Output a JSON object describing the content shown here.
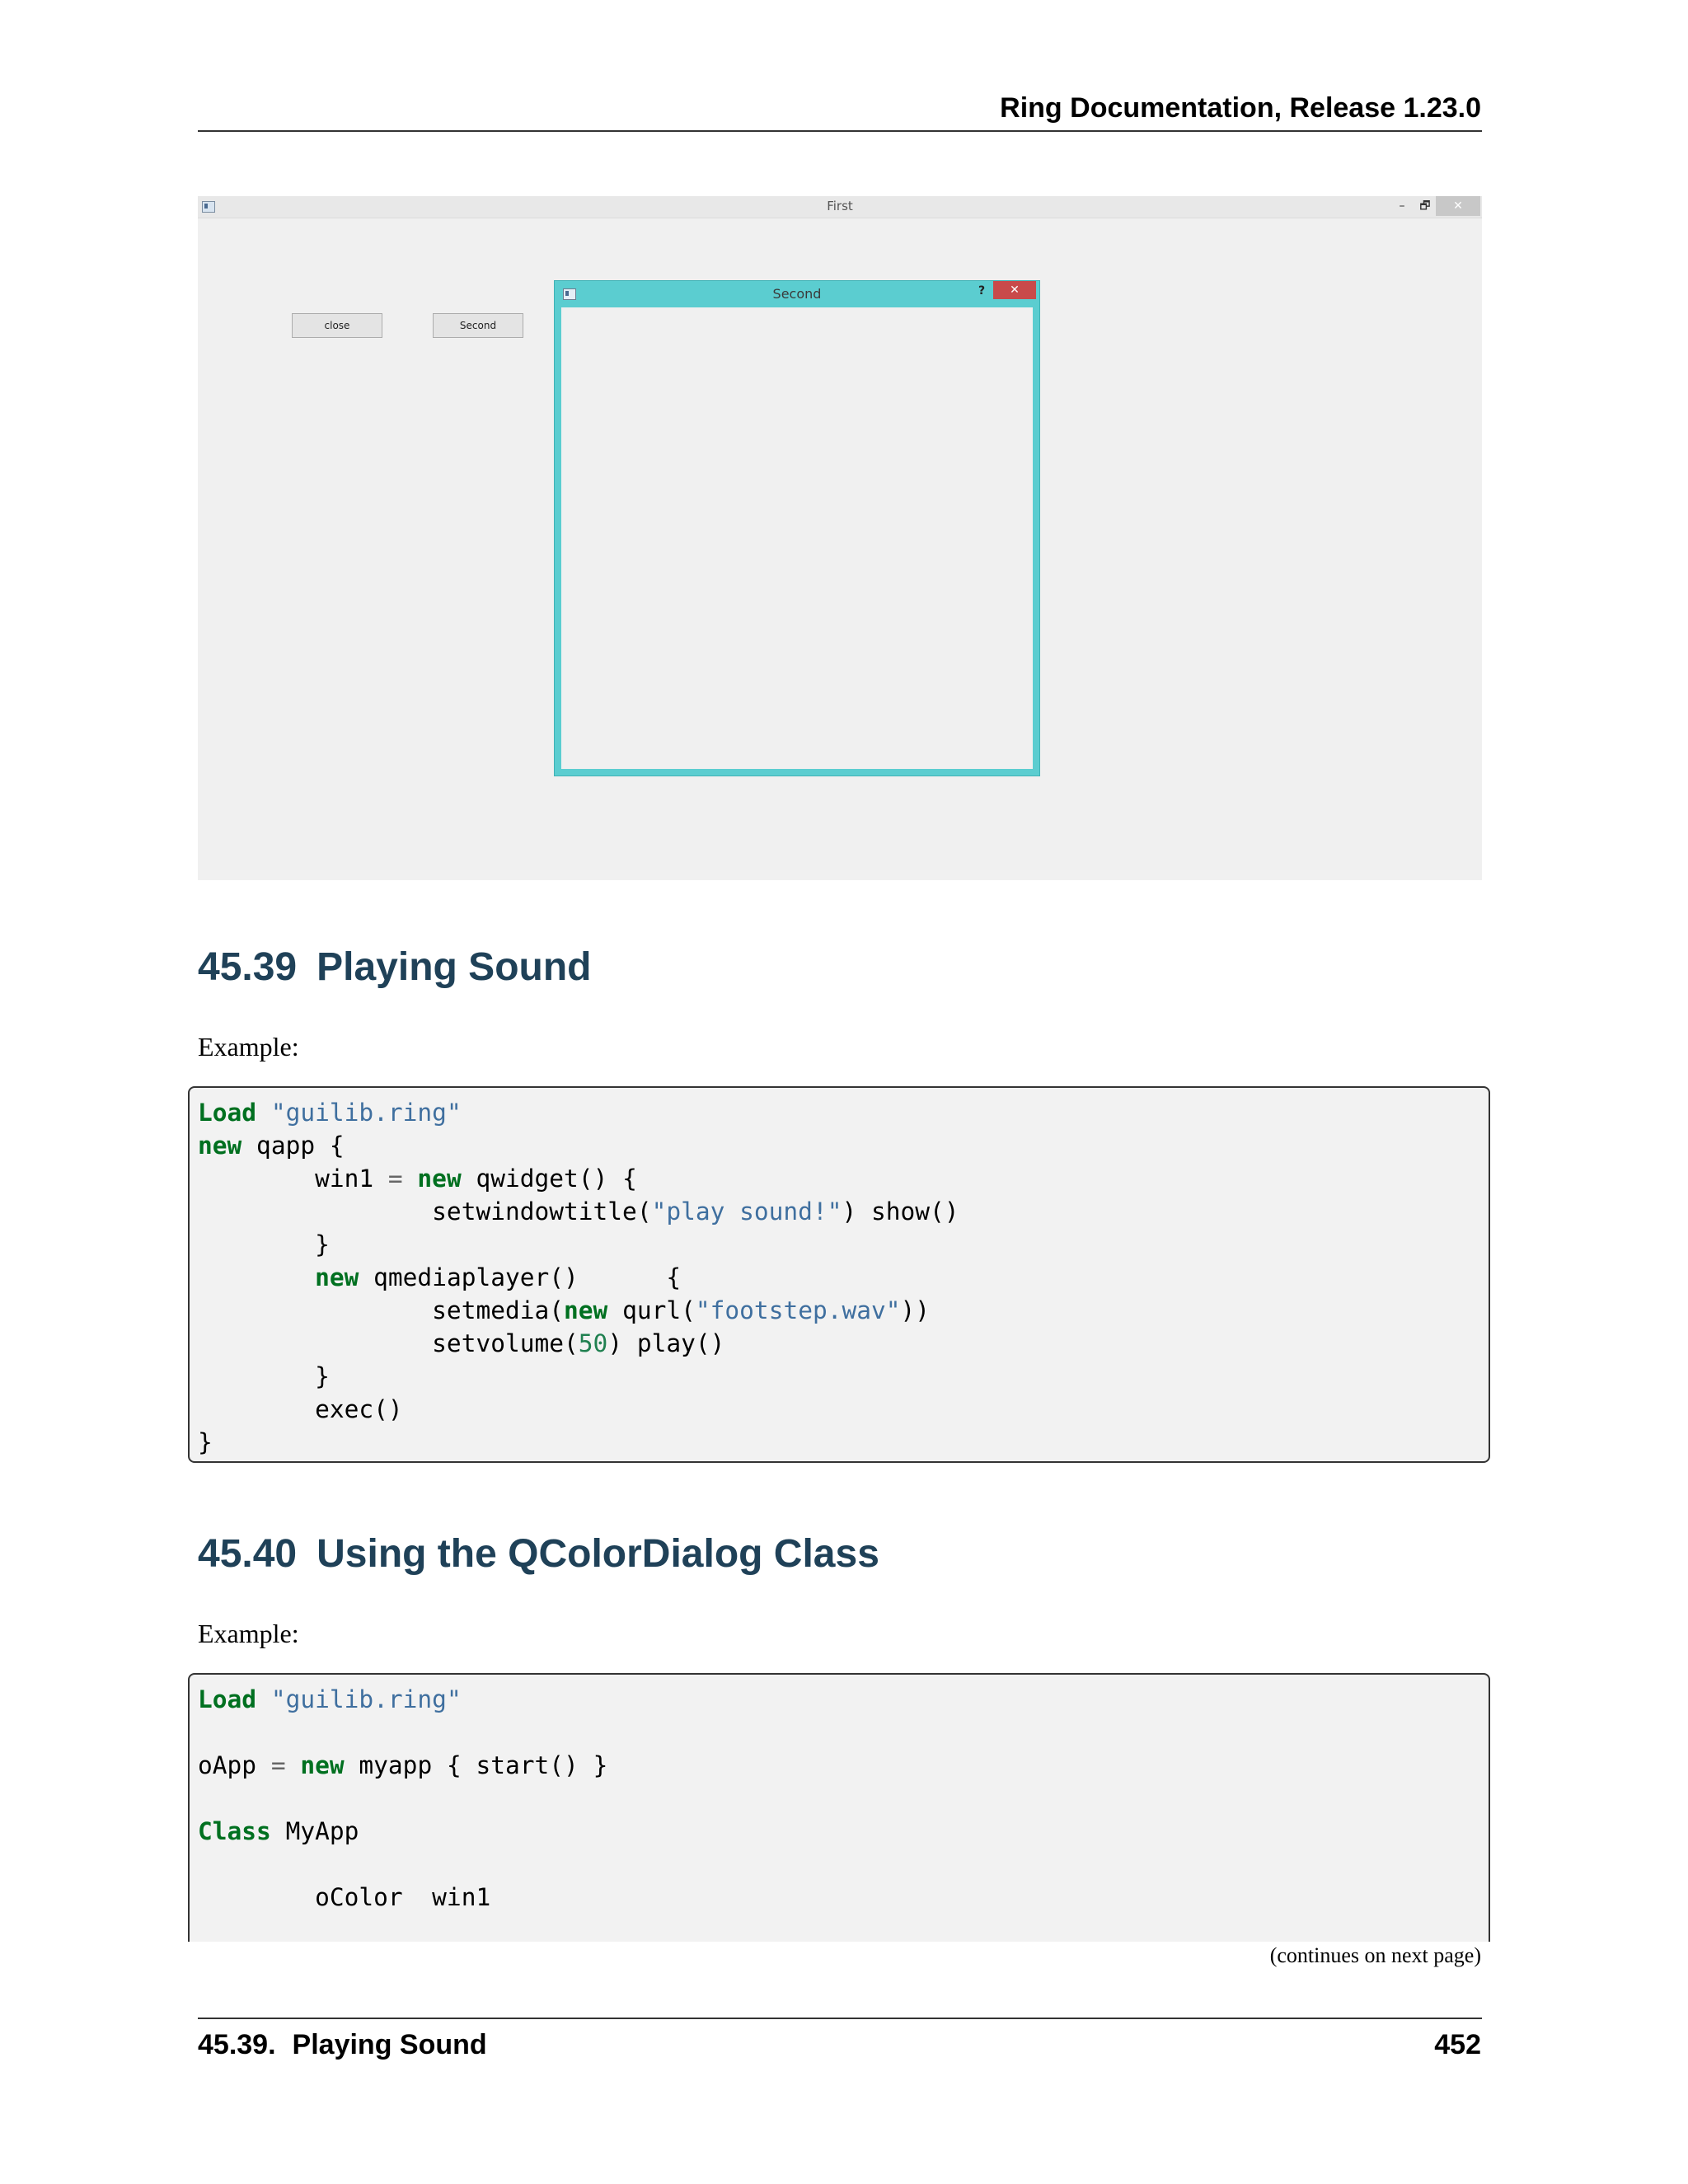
{
  "header": {
    "title": "Ring Documentation, Release 1.23.0"
  },
  "figure": {
    "main_window": {
      "title": "First",
      "minimize_glyph": "–",
      "restore_glyph": "🗗",
      "close_glyph": "✕",
      "buttons": {
        "close_label": "close",
        "second_label": "Second"
      }
    },
    "dialog": {
      "title": "Second",
      "help_glyph": "?",
      "close_glyph": "✕"
    }
  },
  "sections": [
    {
      "number": "45.39",
      "title": "Playing Sound",
      "intro": "Example:"
    },
    {
      "number": "45.40",
      "title": "Using the QColorDialog Class",
      "intro": "Example:"
    }
  ],
  "code_blocks": [
    [
      [
        [
          "kw",
          "Load"
        ],
        [
          "t",
          " "
        ],
        [
          "str",
          "\"guilib.ring\""
        ]
      ],
      [
        [
          "kw",
          "new"
        ],
        [
          "t",
          " qapp {"
        ]
      ],
      [
        [
          "t",
          "        win1 "
        ],
        [
          "op",
          "="
        ],
        [
          "t",
          " "
        ],
        [
          "kw",
          "new"
        ],
        [
          "t",
          " qwidget() {"
        ]
      ],
      [
        [
          "t",
          "                setwindowtitle("
        ],
        [
          "str",
          "\"play sound!\""
        ],
        [
          "t",
          ") show()"
        ]
      ],
      [
        [
          "t",
          "        }"
        ]
      ],
      [
        [
          "t",
          "        "
        ],
        [
          "kw",
          "new"
        ],
        [
          "t",
          " qmediaplayer()      {"
        ]
      ],
      [
        [
          "t",
          "                setmedia("
        ],
        [
          "kw",
          "new"
        ],
        [
          "t",
          " qurl("
        ],
        [
          "str",
          "\"footstep.wav\""
        ],
        [
          "t",
          "))"
        ]
      ],
      [
        [
          "t",
          "                setvolume("
        ],
        [
          "num",
          "50"
        ],
        [
          "t",
          ") play()"
        ]
      ],
      [
        [
          "t",
          "        }"
        ]
      ],
      [
        [
          "t",
          "        exec()"
        ]
      ],
      [
        [
          "t",
          "}"
        ]
      ]
    ],
    [
      [
        [
          "kw",
          "Load"
        ],
        [
          "t",
          " "
        ],
        [
          "str",
          "\"guilib.ring\""
        ]
      ],
      [
        [
          "t",
          ""
        ]
      ],
      [
        [
          "t",
          "oApp "
        ],
        [
          "op",
          "="
        ],
        [
          "t",
          " "
        ],
        [
          "kw",
          "new"
        ],
        [
          "t",
          " myapp { start() }"
        ]
      ],
      [
        [
          "t",
          ""
        ]
      ],
      [
        [
          "kw",
          "Class"
        ],
        [
          "t",
          " MyApp"
        ]
      ],
      [
        [
          "t",
          ""
        ]
      ],
      [
        [
          "t",
          "        oColor  win1"
        ]
      ],
      [
        [
          "t",
          ""
        ]
      ]
    ]
  ],
  "continues_note": "(continues on next page)",
  "footer": {
    "section_number": "45.39.",
    "section_title": "Playing Sound",
    "page_number": "452"
  },
  "colors": {
    "heading": "#1f4158",
    "keyword": "#007020",
    "string": "#3f6f9f",
    "number": "#208050",
    "dialog_frame": "#5bcdd0",
    "dialog_close": "#c94a4a"
  }
}
